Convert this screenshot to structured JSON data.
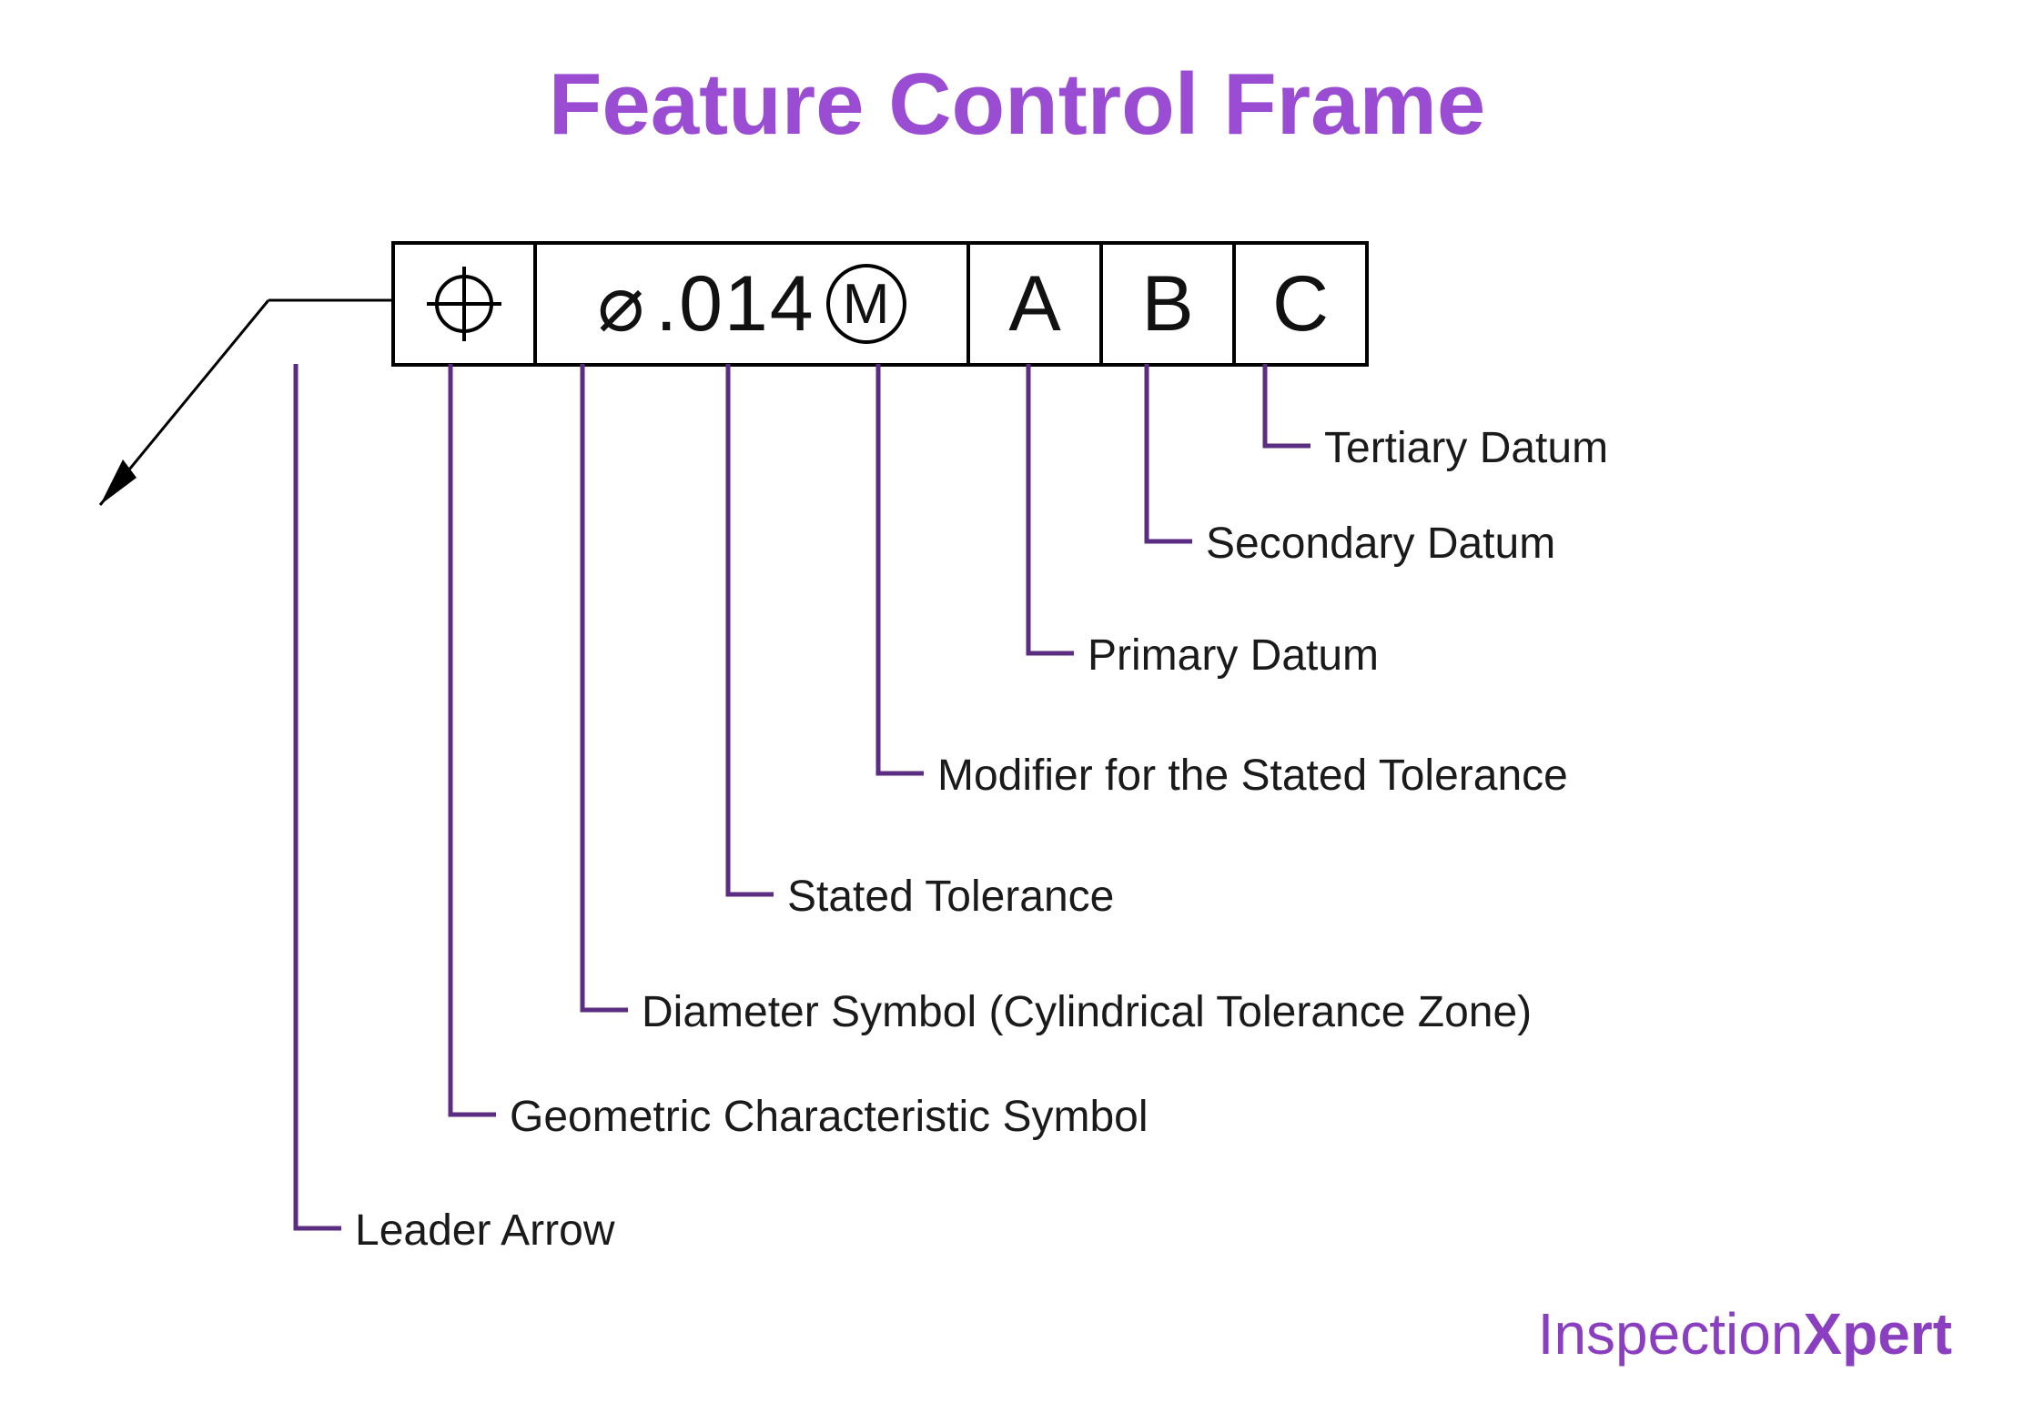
{
  "title": "Feature Control Frame",
  "fcf": {
    "tolerance_value": ".014",
    "modifier": "M",
    "datum_a": "A",
    "datum_b": "B",
    "datum_c": "C"
  },
  "callouts": {
    "tertiary": "Tertiary Datum",
    "secondary": "Secondary Datum",
    "primary": "Primary Datum",
    "modifier": "Modifier for the Stated Tolerance",
    "stated_tolerance": "Stated Tolerance",
    "diameter": "Diameter Symbol (Cylindrical Tolerance Zone)",
    "geometric": "Geometric Characteristic Symbol",
    "leader": "Leader Arrow"
  },
  "colors": {
    "accent": "#9a4dd2",
    "callout_line": "#5a2d82"
  },
  "logo": {
    "part1": "Inspection",
    "part2": "Xpert"
  }
}
